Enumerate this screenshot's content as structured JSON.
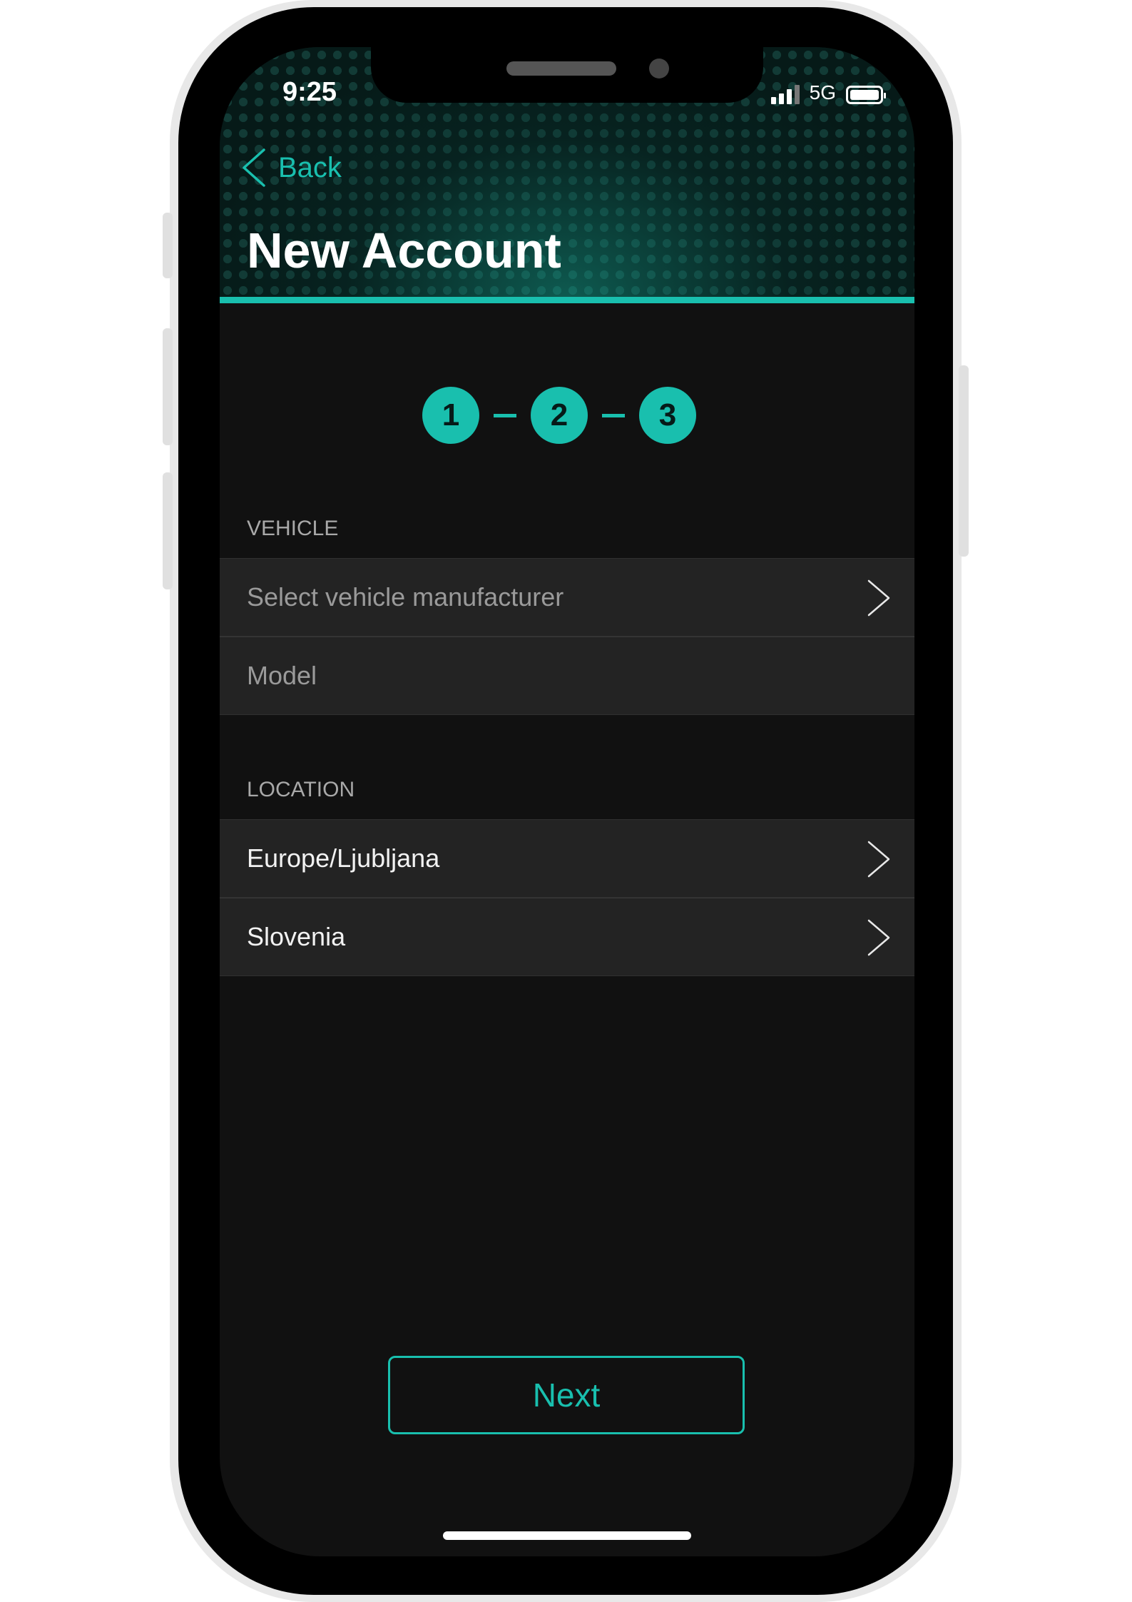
{
  "status_bar": {
    "time": "9:25",
    "network": "5G",
    "icons": [
      "signal-bars-icon",
      "battery-icon"
    ]
  },
  "header": {
    "back_label": "Back",
    "back_icon": "chevron-left-icon",
    "title": "New Account"
  },
  "steps": [
    "1",
    "2",
    "3"
  ],
  "vehicle": {
    "section_label": "VEHICLE",
    "manufacturer_placeholder": "Select vehicle manufacturer",
    "model_placeholder": "Model"
  },
  "location": {
    "section_label": "LOCATION",
    "timezone": "Europe/Ljubljana",
    "country": "Slovenia"
  },
  "footer": {
    "next_label": "Next"
  },
  "colors": {
    "accent": "#19bfae",
    "background": "#111111",
    "row_background": "#232323",
    "section_label": "#a9a9a9"
  }
}
